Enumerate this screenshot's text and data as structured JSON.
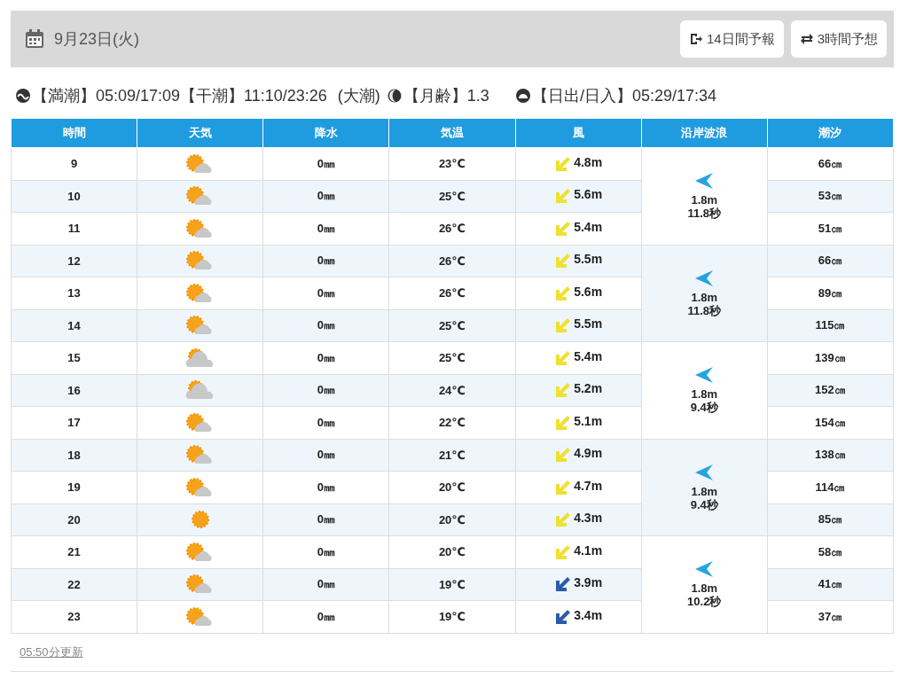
{
  "header": {
    "date": "9月23日(火)",
    "buttons": [
      {
        "label": "14日間予報",
        "kind": "exit"
      },
      {
        "label": "3時間予想",
        "kind": "swap"
      }
    ]
  },
  "tide_info": {
    "high_tide": "【満潮】05:09/17:09",
    "low_tide": "【干潮】11:10/23:26",
    "tide_type": "(大潮)",
    "moon_age": "【月齢】1.3",
    "sun": "【日出/日入】05:29/17:34"
  },
  "table": {
    "columns": [
      "時間",
      "天気",
      "降水",
      "気温",
      "風",
      "沿岸波浪",
      "潮汐"
    ],
    "rows": [
      {
        "hour": "9",
        "weather": {
          "kind": "sun_cloud"
        },
        "rain": "0㎜",
        "temp": "23℃",
        "wind": {
          "color": "#f0e030",
          "speed": "4.8m"
        },
        "tide": "66㎝"
      },
      {
        "hour": "10",
        "weather": {
          "kind": "sun_cloud"
        },
        "rain": "0㎜",
        "temp": "25℃",
        "wind": {
          "color": "#f0e030",
          "speed": "5.6m"
        },
        "tide": "53㎝"
      },
      {
        "hour": "11",
        "weather": {
          "kind": "sun_cloud"
        },
        "rain": "0㎜",
        "temp": "26℃",
        "wind": {
          "color": "#f0e030",
          "speed": "5.4m"
        },
        "tide": "51㎝"
      },
      {
        "hour": "12",
        "weather": {
          "kind": "sun_cloud"
        },
        "rain": "0㎜",
        "temp": "26℃",
        "wind": {
          "color": "#f0e030",
          "speed": "5.5m"
        },
        "tide": "66㎝"
      },
      {
        "hour": "13",
        "weather": {
          "kind": "sun_cloud"
        },
        "rain": "0㎜",
        "temp": "26℃",
        "wind": {
          "color": "#f0e030",
          "speed": "5.6m"
        },
        "tide": "89㎝"
      },
      {
        "hour": "14",
        "weather": {
          "kind": "sun_cloud"
        },
        "rain": "0㎜",
        "temp": "25℃",
        "wind": {
          "color": "#f0e030",
          "speed": "5.5m"
        },
        "tide": "115㎝"
      },
      {
        "hour": "15",
        "weather": {
          "kind": "cloud_sun"
        },
        "rain": "0㎜",
        "temp": "25℃",
        "wind": {
          "color": "#f0e030",
          "speed": "5.4m"
        },
        "tide": "139㎝"
      },
      {
        "hour": "16",
        "weather": {
          "kind": "cloud_sun"
        },
        "rain": "0㎜",
        "temp": "24℃",
        "wind": {
          "color": "#f0e030",
          "speed": "5.2m"
        },
        "tide": "152㎝"
      },
      {
        "hour": "17",
        "weather": {
          "kind": "sun_cloud"
        },
        "rain": "0㎜",
        "temp": "22℃",
        "wind": {
          "color": "#f0e030",
          "speed": "5.1m"
        },
        "tide": "154㎝"
      },
      {
        "hour": "18",
        "weather": {
          "kind": "sun_cloud"
        },
        "rain": "0㎜",
        "temp": "21℃",
        "wind": {
          "color": "#f0e030",
          "speed": "4.9m"
        },
        "tide": "138㎝"
      },
      {
        "hour": "19",
        "weather": {
          "kind": "sun_cloud"
        },
        "rain": "0㎜",
        "temp": "20℃",
        "wind": {
          "color": "#f0e030",
          "speed": "4.7m"
        },
        "tide": "114㎝"
      },
      {
        "hour": "20",
        "weather": {
          "kind": "sun"
        },
        "rain": "0㎜",
        "temp": "20℃",
        "wind": {
          "color": "#f0e030",
          "speed": "4.3m"
        },
        "tide": "85㎝"
      },
      {
        "hour": "21",
        "weather": {
          "kind": "sun_cloud"
        },
        "rain": "0㎜",
        "temp": "20℃",
        "wind": {
          "color": "#f0e030",
          "speed": "4.1m"
        },
        "tide": "58㎝"
      },
      {
        "hour": "22",
        "weather": {
          "kind": "sun_cloud"
        },
        "rain": "0㎜",
        "temp": "19℃",
        "wind": {
          "color": "#2a5caa",
          "speed": "3.9m"
        },
        "tide": "41㎝"
      },
      {
        "hour": "23",
        "weather": {
          "kind": "sun_cloud"
        },
        "rain": "0㎜",
        "temp": "19℃",
        "wind": {
          "color": "#2a5caa",
          "speed": "3.4m"
        },
        "tide": "37㎝"
      }
    ],
    "waves": [
      {
        "height": "1.8m",
        "period": "11.8秒"
      },
      {
        "height": "1.8m",
        "period": "11.8秒"
      },
      {
        "height": "1.8m",
        "period": "9.4秒"
      },
      {
        "height": "1.8m",
        "period": "9.4秒"
      },
      {
        "height": "1.8m",
        "period": "10.2秒"
      }
    ]
  },
  "updated": "05:50分更新"
}
